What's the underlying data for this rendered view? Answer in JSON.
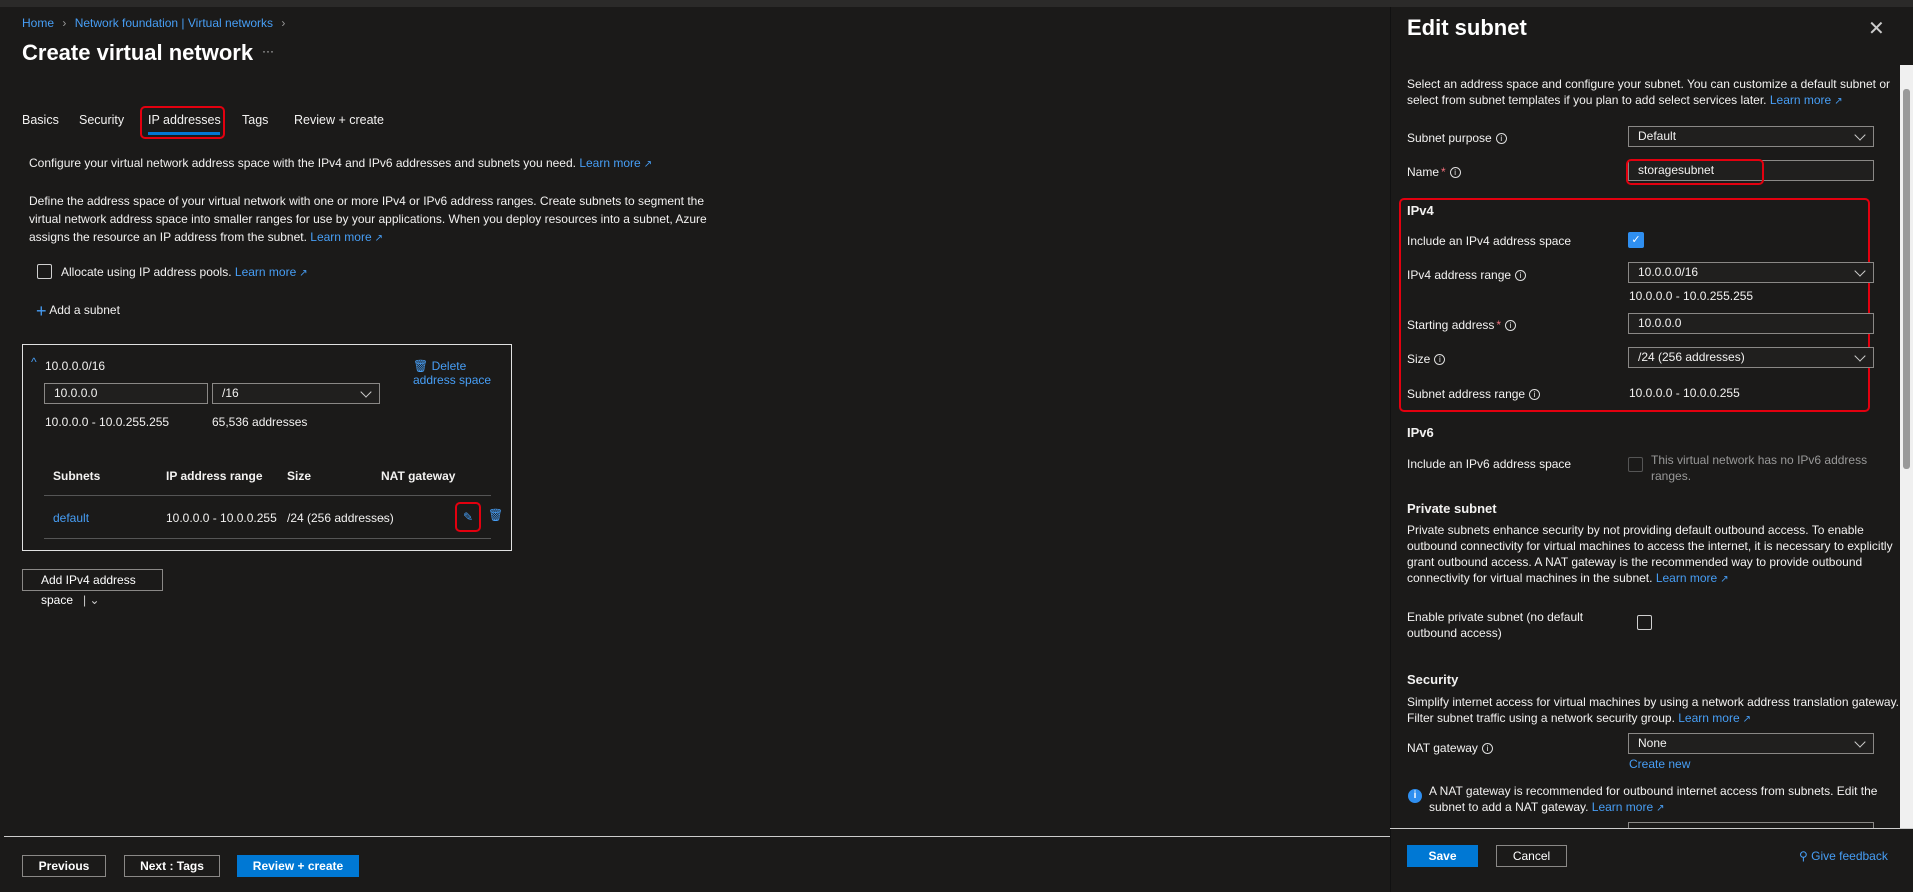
{
  "breadcrumb": {
    "home": "Home",
    "parent": "Network foundation | Virtual networks"
  },
  "page": {
    "title": "Create virtual network",
    "more": "···"
  },
  "tabs": [
    {
      "label": "Basics"
    },
    {
      "label": "Security"
    },
    {
      "label": "IP addresses",
      "active": true
    },
    {
      "label": "Tags"
    },
    {
      "label": "Review + create"
    }
  ],
  "intro": {
    "line1": "Configure your virtual network address space with the IPv4 and IPv6 addresses and subnets you need.",
    "line2a": "Define the address space of your virtual network with one or more IPv4 or IPv6 address ranges. Create subnets to segment the",
    "line2b": "virtual network address space into smaller ranges for use by your applications. When you deploy resources into a subnet, Azure",
    "line2c": "assigns the resource an IP address from the subnet.",
    "learn_more": "Learn more"
  },
  "allocate_pools": {
    "label": "Allocate using IP address pools.",
    "checked": false
  },
  "add_subnet": "Add a subnet",
  "address_space": {
    "cidr": "10.0.0.0/16",
    "delete": "Delete address space",
    "start": "10.0.0.0",
    "prefix": "/16",
    "range": "10.0.0.0 - 10.0.255.255",
    "count": "65,536 addresses",
    "columns": [
      "Subnets",
      "IP address range",
      "Size",
      "NAT gateway"
    ],
    "rows": [
      {
        "name": "default",
        "range": "10.0.0.0 - 10.0.0.255",
        "size": "/24 (256 addresses)",
        "nat": "-"
      }
    ]
  },
  "add_ipv4": "Add IPv4 address space",
  "footer": {
    "previous": "Previous",
    "next": "Next : Tags",
    "review": "Review + create"
  },
  "panel": {
    "title": "Edit subnet",
    "desc1": "Select an address space and configure your subnet. You can customize a default subnet or",
    "desc2": "select from subnet templates if you plan to add select services later.",
    "learn_more": "Learn more",
    "subnet_purpose_label": "Subnet purpose",
    "subnet_purpose": "Default",
    "name_label": "Name",
    "name": "storagesubnet",
    "ipv4_heading": "IPv4",
    "include_ipv4_label": "Include an IPv4 address space",
    "include_ipv4": true,
    "ipv4_range_label": "IPv4 address range",
    "ipv4_range": "10.0.0.0/16",
    "ipv4_range_text": "10.0.0.0 - 10.0.255.255",
    "starting_label": "Starting address",
    "starting": "10.0.0.0",
    "size_label": "Size",
    "size": "/24 (256 addresses)",
    "subnet_range_label": "Subnet address range",
    "subnet_range": "10.0.0.0 - 10.0.0.255",
    "ipv6_heading": "IPv6",
    "include_ipv6_label": "Include an IPv6 address space",
    "ipv6_note1": "This virtual network has no IPv6 address",
    "ipv6_note2": "ranges.",
    "private_heading": "Private subnet",
    "private1": "Private subnets enhance security by not providing default outbound access. To enable",
    "private2": "outbound connectivity for virtual machines to access the internet, it is necessary to explicitly",
    "private3": "grant outbound access. A NAT gateway is the recommended way to provide outbound",
    "private4": "connectivity for virtual machines in the subnet.",
    "enable_private1": "Enable private subnet (no default",
    "enable_private2": "outbound access)",
    "enable_private": false,
    "security_heading": "Security",
    "security1": "Simplify internet access for virtual machines by using a network address translation gateway.",
    "security2": "Filter subnet traffic using a network security group.",
    "nat_label": "NAT gateway",
    "nat": "None",
    "create_new": "Create new",
    "nat_info1": "A NAT gateway is recommended for outbound internet access from subnets. Edit the",
    "nat_info2": "subnet to add a NAT gateway.",
    "save": "Save",
    "cancel": "Cancel",
    "feedback": "Give feedback"
  }
}
